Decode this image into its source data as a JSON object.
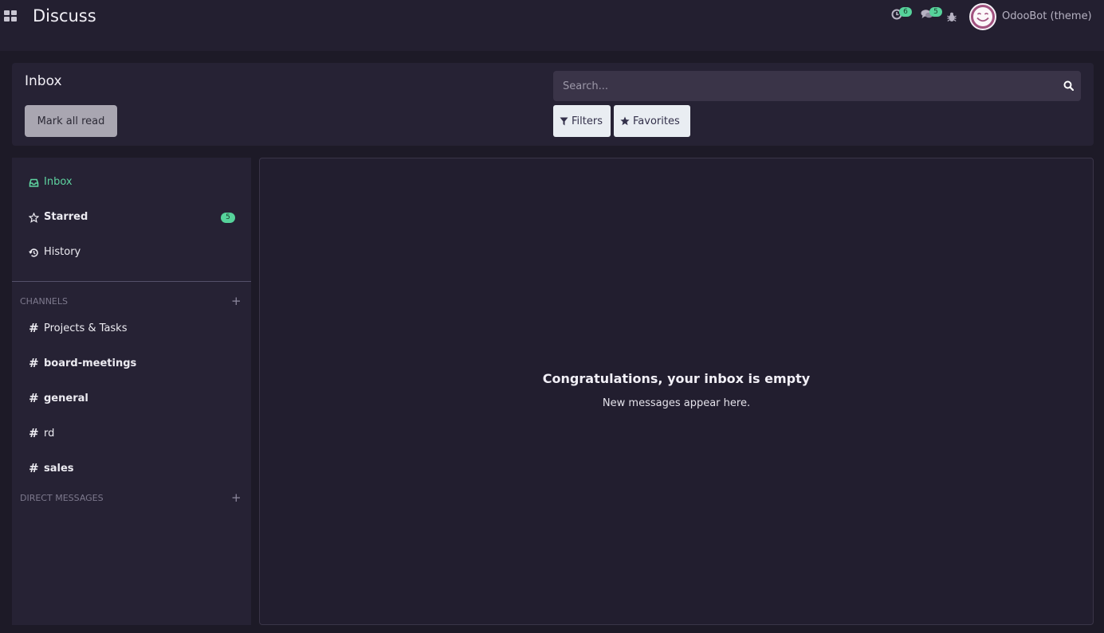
{
  "navbar": {
    "app_title": "Discuss",
    "activity_count": "6",
    "messages_count": "5",
    "user_name": "OdooBot (theme)"
  },
  "control_panel": {
    "title": "Inbox",
    "mark_all_read": "Mark all read",
    "search_placeholder": "Search...",
    "filters": "Filters",
    "favorites": "Favorites"
  },
  "sidebar": {
    "mailboxes": [
      {
        "label": "Inbox",
        "icon": "inbox-icon"
      },
      {
        "label": "Starred",
        "icon": "star-icon",
        "count": "5"
      },
      {
        "label": "History",
        "icon": "history-icon"
      }
    ],
    "channels_header": "CHANNELS",
    "channels": [
      {
        "label": "Projects & Tasks"
      },
      {
        "label": "board-meetings"
      },
      {
        "label": "general"
      },
      {
        "label": "rd"
      },
      {
        "label": "sales"
      }
    ],
    "direct_messages_header": "DIRECT MESSAGES"
  },
  "main": {
    "empty_title": "Congratulations, your inbox is empty",
    "empty_subtitle": "New messages appear here."
  },
  "colors": {
    "accent": "#56d39b",
    "background": "#1d1a27",
    "panel": "#262234"
  }
}
